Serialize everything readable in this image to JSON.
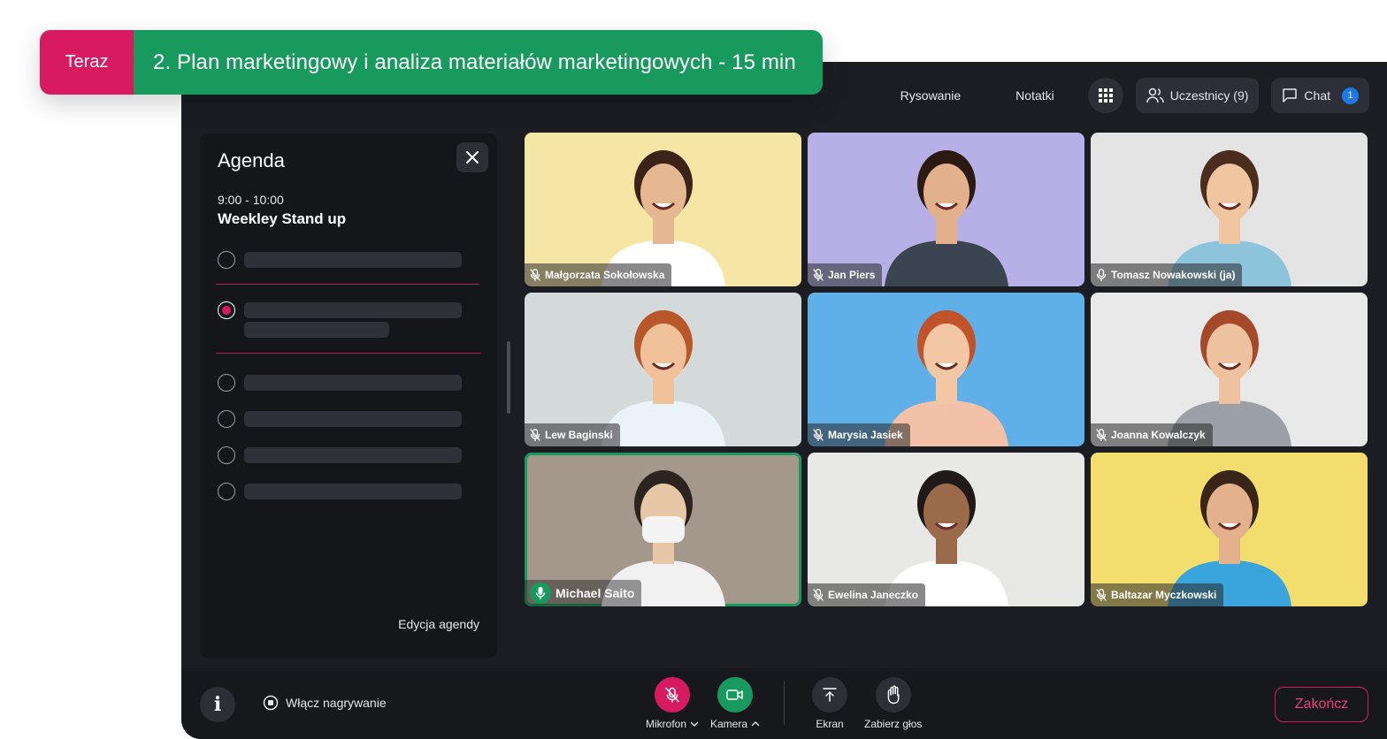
{
  "now_bar": {
    "badge": "Teraz",
    "title": "2. Plan marketingowy i analiza materiałów marketingowych - 15 min"
  },
  "topbar": {
    "drawing_label": "Rysowanie",
    "notes_label": "Notatki",
    "participants_label": "Uczestnicy (9)",
    "chat_label": "Chat",
    "chat_badge": "1"
  },
  "agenda": {
    "title": "Agenda",
    "time": "9:00 - 10:00",
    "meeting_name": "Weekley Stand up",
    "edit_label": "Edycja agendy",
    "items": [
      {
        "state": "todo"
      },
      {
        "state": "current"
      },
      {
        "state": "todo"
      },
      {
        "state": "todo"
      },
      {
        "state": "todo"
      },
      {
        "state": "todo"
      }
    ]
  },
  "participants": [
    {
      "name": "Małgorzata Sokołowska",
      "muted": true,
      "bg": "#f6e6a6"
    },
    {
      "name": "Jan Piers",
      "muted": true,
      "bg": "#b7b0e6"
    },
    {
      "name": "Tomasz Nowakowski (ja)",
      "muted": false,
      "bg": "#e4e4e4"
    },
    {
      "name": "Lew Baginski",
      "muted": true,
      "bg": "#d3dad9"
    },
    {
      "name": "Marysia Jasiek",
      "muted": true,
      "bg": "#5fb0e8"
    },
    {
      "name": "Joanna Kowalczyk",
      "muted": true,
      "bg": "#e9e9e9"
    },
    {
      "name": "Michael Saito",
      "muted": false,
      "speaking": true,
      "bg": "#a4978c"
    },
    {
      "name": "Ewelina Janeczko",
      "muted": true,
      "bg": "#e8e8e6"
    },
    {
      "name": "Baltazar Myczkowski",
      "muted": true,
      "bg": "#f3dd6d"
    }
  ],
  "bottombar": {
    "record_label": "Włącz nagrywanie",
    "mic_label": "Mikrofon",
    "camera_label": "Kamera",
    "screen_label": "Ekran",
    "raise_hand_label": "Zabierz głos",
    "end_label": "Zakończ",
    "info_glyph": "i"
  },
  "colors": {
    "accent_pink": "#d81b60",
    "accent_green": "#189a5e",
    "app_bg": "#1b1d22",
    "chat_badge": "#1d78e8"
  }
}
